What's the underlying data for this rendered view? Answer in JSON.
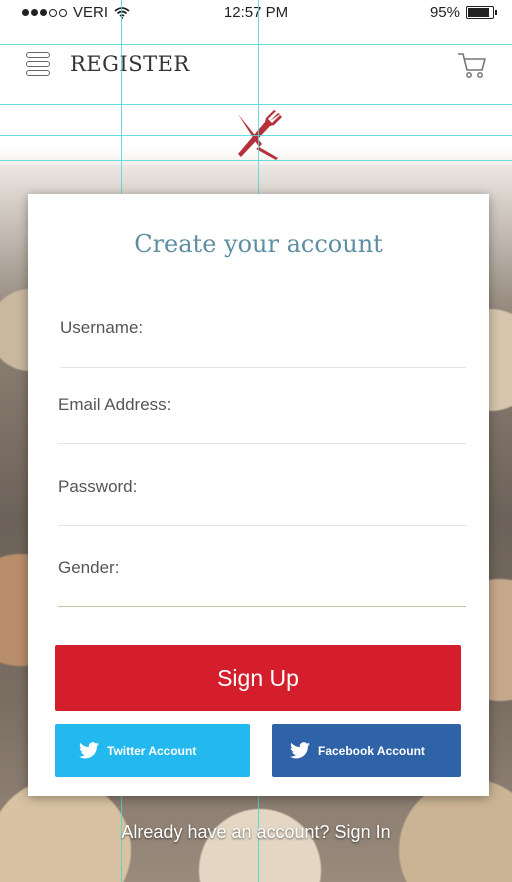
{
  "status_bar": {
    "carrier": "VERI",
    "time": "12:57 PM",
    "battery": "95%"
  },
  "header": {
    "title": "REGISTER"
  },
  "form": {
    "title": "Create your account",
    "fields": {
      "username": "Username:",
      "email": "Email Address:",
      "password": "Password:",
      "gender": "Gender:"
    },
    "signup_label": "Sign Up",
    "twitter_label": "Twitter Account",
    "facebook_label": "Facebook Account"
  },
  "footer": {
    "signin_text": "Already have an account? Sign In"
  },
  "colors": {
    "accent_red": "#d51e2b",
    "twitter_blue": "#23b9ef",
    "facebook_blue": "#2e63a8",
    "title_blue": "#5d8ea3"
  },
  "icons": [
    "menu-icon",
    "cart-icon",
    "fork-knife-logo",
    "wifi-icon",
    "battery-icon",
    "twitter-bird-icon"
  ]
}
